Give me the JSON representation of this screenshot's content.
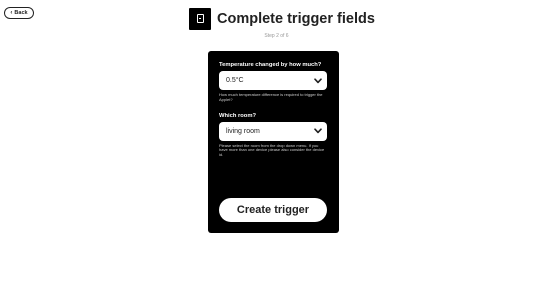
{
  "back": {
    "label": "Back",
    "icon": "chevron-left-icon"
  },
  "header": {
    "logo_icon": "device-service-icon",
    "title": "Complete trigger fields"
  },
  "step": {
    "text": "Step 2 of 6"
  },
  "form": {
    "fields": [
      {
        "label": "Temperature changed by how much?",
        "value": "0.5°C",
        "helper": "How much temperature difference is required to trigger the Applet?"
      },
      {
        "label": "Which room?",
        "value": "living room",
        "helper": "Please select the room from the drop down menu. If you have more than one device please also consider the device id."
      }
    ],
    "submit_label": "Create trigger"
  },
  "colors": {
    "card_background": "#000000",
    "page_background": "#ffffff",
    "text_dark": "#222222",
    "muted": "#999999"
  }
}
